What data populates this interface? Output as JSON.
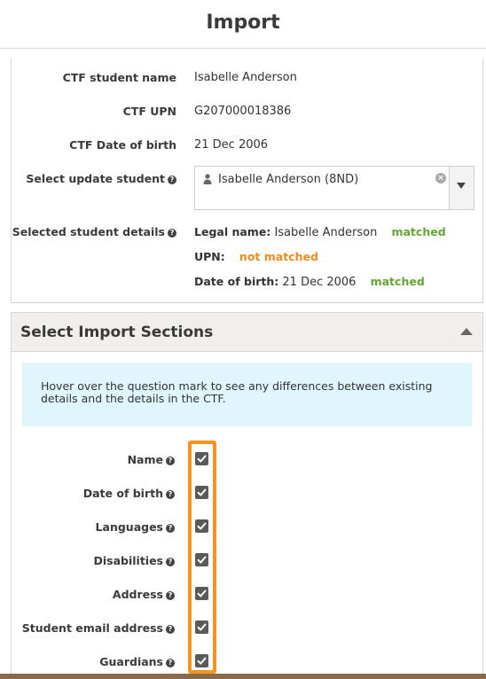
{
  "header": {
    "title": "Import"
  },
  "student": {
    "ctf_name_label": "CTF student name",
    "ctf_name_value": "Isabelle Anderson",
    "ctf_upn_label": "CTF UPN",
    "ctf_upn_value": "G207000018386",
    "ctf_dob_label": "CTF Date of birth",
    "ctf_dob_value": "21 Dec 2006",
    "update_label": "Select update student",
    "update_value": "Isabelle Anderson (8ND)",
    "details_label": "Selected student details",
    "legal_name_key": "Legal name:",
    "legal_name_value": "Isabelle Anderson",
    "legal_name_status": "matched",
    "upn_key": "UPN:",
    "upn_status": "not matched",
    "dob_key": "Date of birth:",
    "dob_value": "21 Dec 2006",
    "dob_status": "matched"
  },
  "import_sections": {
    "title": "Select Import Sections",
    "info": "Hover over the question mark to see any differences between existing details and the details in the CTF.",
    "items": [
      {
        "label": "Name",
        "checked": true
      },
      {
        "label": "Date of birth",
        "checked": true
      },
      {
        "label": "Languages",
        "checked": true
      },
      {
        "label": "Disabilities",
        "checked": true
      },
      {
        "label": "Address",
        "checked": true
      },
      {
        "label": "Student email address",
        "checked": true
      },
      {
        "label": "Guardians",
        "checked": true
      }
    ]
  },
  "colors": {
    "matched": "#62a832",
    "not_matched": "#f28c1b",
    "highlight": "#f7931e",
    "info_bg": "#dff6fc"
  }
}
